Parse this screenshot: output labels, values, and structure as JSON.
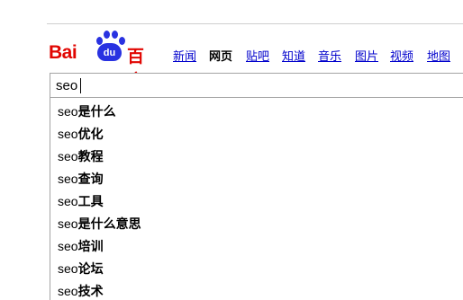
{
  "logo": {
    "latin": "Bai",
    "paw_text": "du",
    "chinese": "百度",
    "brand_red": "#e10602",
    "brand_blue": "#2932e1"
  },
  "nav": [
    {
      "label": "新闻",
      "active": false
    },
    {
      "label": "网页",
      "active": true
    },
    {
      "label": "贴吧",
      "active": false
    },
    {
      "label": "知道",
      "active": false
    },
    {
      "label": "音乐",
      "active": false
    },
    {
      "label": "图片",
      "active": false
    },
    {
      "label": "视频",
      "active": false
    },
    {
      "label": "地图",
      "active": false
    }
  ],
  "search": {
    "value": "seo"
  },
  "suggestions": [
    {
      "query": "seo",
      "rest": "是什么"
    },
    {
      "query": "seo",
      "rest": "优化"
    },
    {
      "query": "seo",
      "rest": "教程"
    },
    {
      "query": "seo",
      "rest": "查询"
    },
    {
      "query": "seo",
      "rest": "工具"
    },
    {
      "query": "seo",
      "rest": "是什么意思"
    },
    {
      "query": "seo",
      "rest": "培训"
    },
    {
      "query": "seo",
      "rest": "论坛"
    },
    {
      "query": "seo",
      "rest": "技术"
    }
  ]
}
